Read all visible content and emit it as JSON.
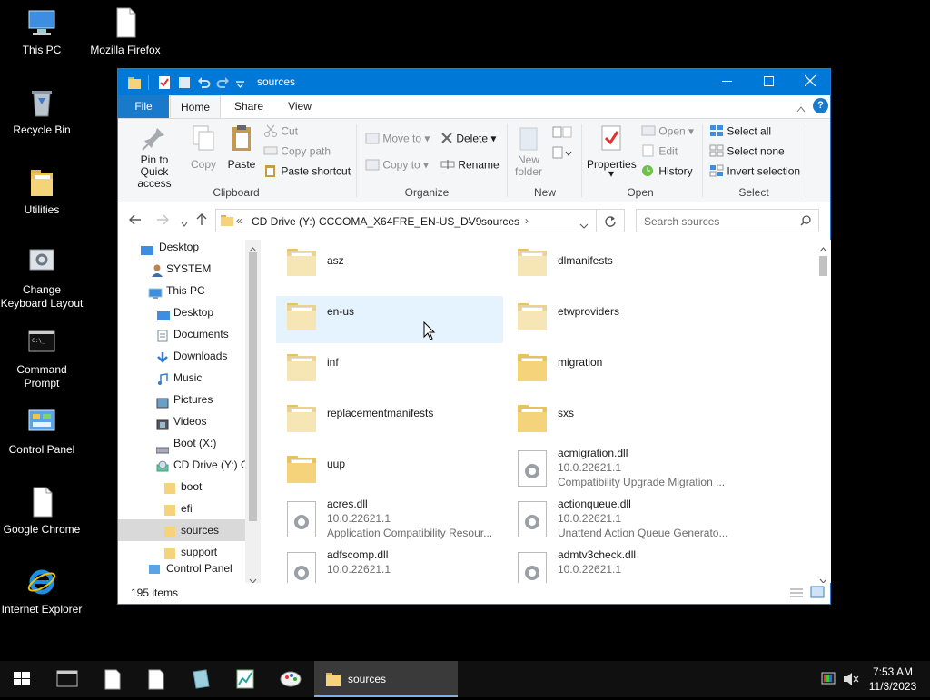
{
  "desktop": {
    "icons": [
      {
        "label": "This PC",
        "icon": "this-pc-icon"
      },
      {
        "label": "Mozilla Firefox",
        "icon": "file-icon"
      },
      {
        "label": "Recycle Bin",
        "icon": "recycle-bin-icon"
      },
      {
        "label": "Utilities",
        "icon": "folder-icon"
      },
      {
        "label": "Change Keyboard Layout",
        "icon": "keyboard-settings-icon"
      },
      {
        "label": "Command Prompt",
        "icon": "cmd-icon"
      },
      {
        "label": "Control Panel",
        "icon": "control-panel-icon"
      },
      {
        "label": "Google Chrome",
        "icon": "file-icon"
      },
      {
        "label": "Internet Explorer",
        "icon": "ie-icon"
      }
    ]
  },
  "window": {
    "title": "sources",
    "tabs": [
      "File",
      "Home",
      "Share",
      "View"
    ],
    "ribbon": {
      "clipboard": {
        "pin": "Pin to Quick access",
        "copy": "Copy",
        "paste": "Paste",
        "cut": "Cut",
        "copy_path": "Copy path",
        "paste_shortcut": "Paste shortcut",
        "group": "Clipboard"
      },
      "organize": {
        "move_to": "Move to",
        "copy_to": "Copy to",
        "delete": "Delete",
        "rename": "Rename",
        "group": "Organize"
      },
      "new": {
        "new_folder": "New folder",
        "group": "New"
      },
      "open": {
        "properties": "Properties",
        "open": "Open",
        "edit": "Edit",
        "history": "History",
        "group": "Open"
      },
      "select": {
        "select_all": "Select all",
        "select_none": "Select none",
        "invert": "Invert selection",
        "group": "Select"
      }
    },
    "address": {
      "overflow": "«",
      "crumbs": [
        "CD Drive (Y:) CCCOMA_X64FRE_EN-US_DV9",
        "sources"
      ],
      "search_placeholder": "Search sources"
    },
    "nav": [
      {
        "label": "Desktop",
        "icon": "desktop-icon",
        "indent": 0
      },
      {
        "label": "SYSTEM",
        "icon": "user-icon",
        "indent": 1
      },
      {
        "label": "This PC",
        "icon": "this-pc-icon",
        "indent": 1
      },
      {
        "label": "Desktop",
        "icon": "desktop-icon",
        "indent": 2
      },
      {
        "label": "Documents",
        "icon": "documents-icon",
        "indent": 2
      },
      {
        "label": "Downloads",
        "icon": "downloads-icon",
        "indent": 2
      },
      {
        "label": "Music",
        "icon": "music-icon",
        "indent": 2
      },
      {
        "label": "Pictures",
        "icon": "pictures-icon",
        "indent": 2
      },
      {
        "label": "Videos",
        "icon": "videos-icon",
        "indent": 2
      },
      {
        "label": "Boot (X:)",
        "icon": "drive-icon",
        "indent": 2
      },
      {
        "label": "CD Drive (Y:) C",
        "icon": "cd-drive-icon",
        "indent": 2
      },
      {
        "label": "boot",
        "icon": "folder-icon",
        "indent": 3
      },
      {
        "label": "efi",
        "icon": "folder-icon",
        "indent": 3
      },
      {
        "label": "sources",
        "icon": "folder-icon",
        "indent": 3,
        "selected": true
      },
      {
        "label": "support",
        "icon": "folder-icon",
        "indent": 3
      },
      {
        "label": "Control Panel",
        "icon": "control-panel-icon",
        "indent": 1
      }
    ],
    "items": [
      {
        "name": "asz",
        "type": "folder"
      },
      {
        "name": "dlmanifests",
        "type": "folder"
      },
      {
        "name": "en-us",
        "type": "folder",
        "hover": true
      },
      {
        "name": "etwproviders",
        "type": "folder"
      },
      {
        "name": "inf",
        "type": "folder"
      },
      {
        "name": "migration",
        "type": "folder"
      },
      {
        "name": "replacementmanifests",
        "type": "folder"
      },
      {
        "name": "sxs",
        "type": "folder"
      },
      {
        "name": "uup",
        "type": "folder"
      },
      {
        "name": "acmigration.dll",
        "type": "dll",
        "version": "10.0.22621.1",
        "desc": "Compatibility Upgrade Migration ..."
      },
      {
        "name": "acres.dll",
        "type": "dll",
        "version": "10.0.22621.1",
        "desc": "Application Compatibility Resour..."
      },
      {
        "name": "actionqueue.dll",
        "type": "dll",
        "version": "10.0.22621.1",
        "desc": "Unattend Action Queue Generato..."
      },
      {
        "name": "adfscomp.dll",
        "type": "dll",
        "version": "10.0.22621.1",
        "desc": ""
      },
      {
        "name": "admtv3check.dll",
        "type": "dll",
        "version": "10.0.22621.1",
        "desc": ""
      }
    ],
    "status": "195 items"
  },
  "taskbar": {
    "active_label": "sources",
    "time": "7:53 AM",
    "date": "11/3/2023"
  },
  "colors": {
    "titlebar": "#0078d7",
    "file_tab": "#1979ca",
    "selection": "#cce8ff",
    "hover": "#e5f3ff",
    "folder": "#f5d37a"
  }
}
